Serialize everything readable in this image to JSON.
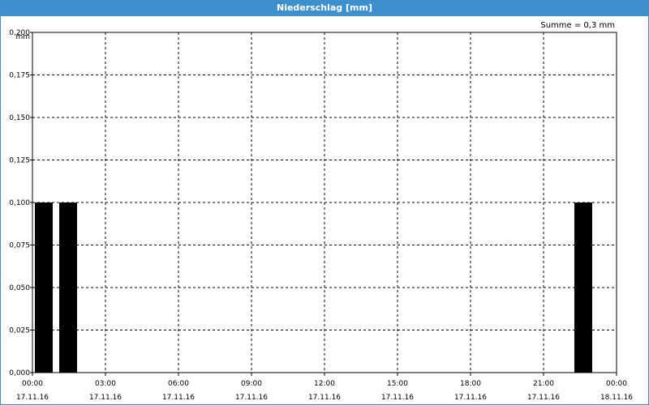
{
  "window": {
    "title": "Niederschlag [mm]"
  },
  "summary": "Summe = 0,3 mm",
  "colors": {
    "titlebar": "#3e8fcb",
    "bar": "#000000",
    "grid": "#000000"
  },
  "chart_data": {
    "type": "bar",
    "title": "Niederschlag [mm]",
    "ylabel": "mm",
    "xlabel": "",
    "ylim": [
      0,
      0.2
    ],
    "xlim": [
      "17.11.16 00:00",
      "18.11.16 00:00"
    ],
    "grid": true,
    "y_ticks": [
      {
        "value": 0,
        "label": "0,000"
      },
      {
        "value": 0.025,
        "label": "0,025"
      },
      {
        "value": 0.05,
        "label": "0,050"
      },
      {
        "value": 0.075,
        "label": "0,075"
      },
      {
        "value": 0.1,
        "label": "0,100"
      },
      {
        "value": 0.125,
        "label": "0,125"
      },
      {
        "value": 0.15,
        "label": "0,150"
      },
      {
        "value": 0.175,
        "label": "0,175"
      },
      {
        "value": 0.2,
        "label": "0,200"
      }
    ],
    "x_ticks": [
      {
        "hour": 0,
        "time": "00:00",
        "date": "17.11.16"
      },
      {
        "hour": 3,
        "time": "03:00",
        "date": "17.11.16"
      },
      {
        "hour": 6,
        "time": "06:00",
        "date": "17.11.16"
      },
      {
        "hour": 9,
        "time": "09:00",
        "date": "17.11.16"
      },
      {
        "hour": 12,
        "time": "12:00",
        "date": "17.11.16"
      },
      {
        "hour": 15,
        "time": "15:00",
        "date": "17.11.16"
      },
      {
        "hour": 18,
        "time": "18:00",
        "date": "17.11.16"
      },
      {
        "hour": 21,
        "time": "21:00",
        "date": "17.11.16"
      },
      {
        "hour": 24,
        "time": "00:00",
        "date": "18.11.16"
      }
    ],
    "bars": [
      {
        "start": "17.11.16 00:00",
        "end": "17.11.16 00:50",
        "value": 0.1
      },
      {
        "start": "17.11.16 01:00",
        "end": "17.11.16 01:50",
        "value": 0.1
      },
      {
        "start": "17.11.16 22:10",
        "end": "17.11.16 23:00",
        "value": 0.1
      }
    ]
  }
}
